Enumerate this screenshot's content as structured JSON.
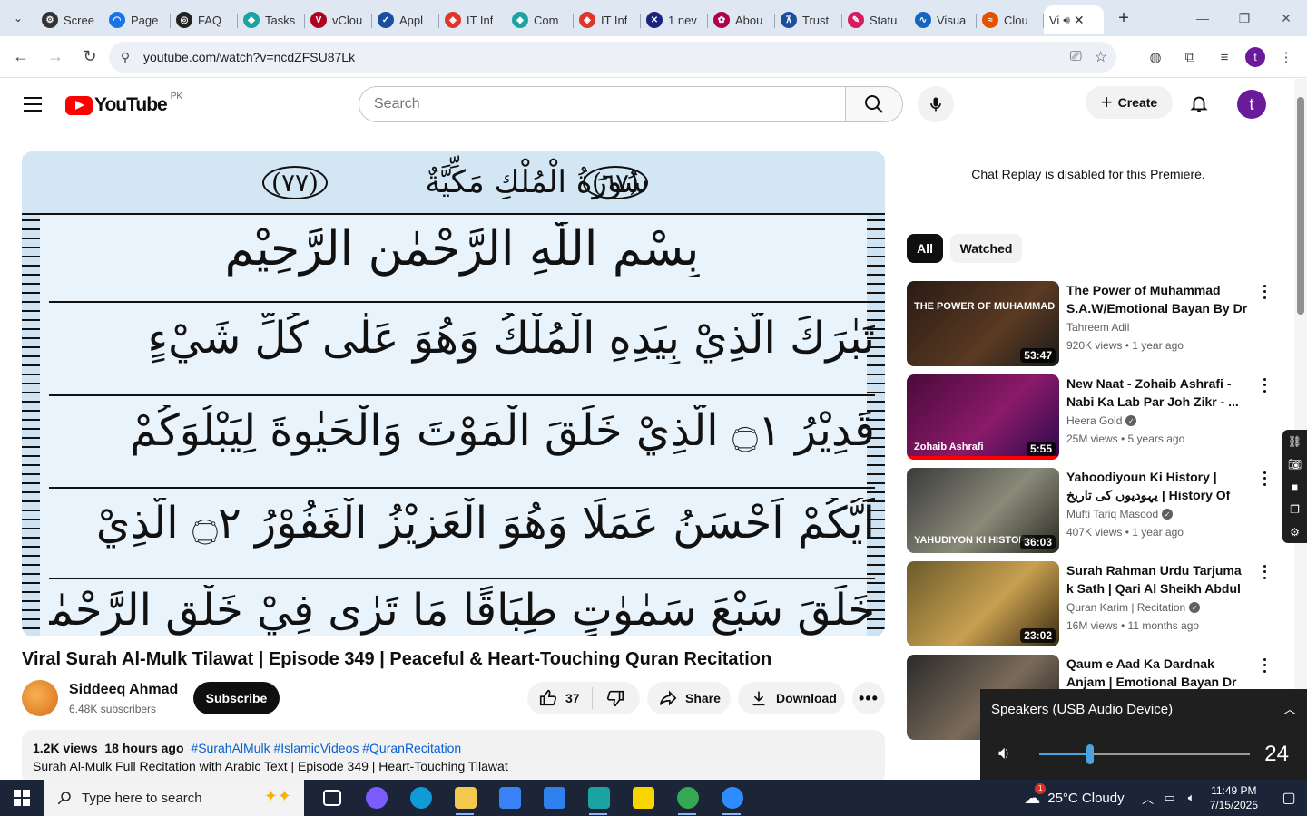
{
  "browser": {
    "tabs": [
      {
        "label": "Scree",
        "color": "#333333",
        "glyph": "⚙"
      },
      {
        "label": "Page",
        "color": "#1a73e8",
        "glyph": "◠"
      },
      {
        "label": "FAQ",
        "color": "#222222",
        "glyph": "◎"
      },
      {
        "label": "Tasks",
        "color": "#1aa3a3",
        "glyph": "◆"
      },
      {
        "label": "vClou",
        "color": "#b00020",
        "glyph": "V"
      },
      {
        "label": "Appl",
        "color": "#1a4fa0",
        "glyph": "✓"
      },
      {
        "label": "IT Inf",
        "color": "#e0352b",
        "glyph": "◈"
      },
      {
        "label": "Com",
        "color": "#1aa3a3",
        "glyph": "◆"
      },
      {
        "label": "IT Inf",
        "color": "#e0352b",
        "glyph": "◈"
      },
      {
        "label": "1 nev",
        "color": "#1a237e",
        "glyph": "✕"
      },
      {
        "label": "Abou",
        "color": "#b0004a",
        "glyph": "✿"
      },
      {
        "label": "Trust",
        "color": "#1a4fa0",
        "glyph": "⊼"
      },
      {
        "label": "Statu",
        "color": "#d81b60",
        "glyph": "✎"
      },
      {
        "label": "Visua",
        "color": "#1565c0",
        "glyph": "∿"
      },
      {
        "label": "Clou",
        "color": "#e65100",
        "glyph": "≈"
      }
    ],
    "active_tab": {
      "label": "Vi"
    },
    "url": "youtube.com/watch?v=ncdZFSU87Lk"
  },
  "yt": {
    "region": "PK",
    "logo_text": "YouTube",
    "search_placeholder": "Search",
    "create_label": "Create",
    "avatar_letter": "t"
  },
  "video": {
    "title": "Viral Surah Al-Mulk Tilawat | Episode 349 | Peaceful & Heart-Touching Quran Recitation",
    "channel": "Siddeeq Ahmad",
    "subscribers": "6.48K subscribers",
    "subscribe_label": "Subscribe",
    "likes": "37",
    "share_label": "Share",
    "download_label": "Download",
    "views": "1.2K views",
    "time": "18 hours ago",
    "tags": "#SurahAlMulk #IslamicVideos #QuranRecitation",
    "description_line": "Surah Al-Mulk Full Recitation with Arabic Text | Episode 349 | Heart-Touching Tilawat",
    "frame": {
      "header": "سُورَةُ الْمُلْكِ مَكِّيَّةٌ",
      "left_num": "(٧٧)",
      "right_num": "(٦٧)",
      "line1": "بِسْمِ اللّٰهِ الرَّحْمٰنِ الرَّحِيْمِ",
      "line2": "تَبٰرَكَ الَّذِيْ بِيَدِهِ الْمُلْكُ وَهُوَ عَلٰى كُلِّ شَيْءٍ",
      "line3": "قَدِيْرُ ۝١ الَّذِيْ خَلَقَ الْمَوْتَ وَالْحَيٰوةَ لِيَبْلُوَكُمْ",
      "line4": "اَيُّكُمْ اَحْسَنُ عَمَلًا وَهُوَ الْعَزِيْزُ الْغَفُوْرُ ۝٢ الَّذِيْ",
      "line5": "خَلَقَ سَبْعَ سَمٰوٰتٍ طِبَاقًا مَا تَرٰى فِيْ خَلْقِ الرَّحْمٰنِ"
    }
  },
  "sidebar": {
    "chat_replay": "Chat Replay is disabled for this Premiere.",
    "chips": [
      "All",
      "Watched"
    ],
    "recs": [
      {
        "title": "The Power of Muhammad S.A.W/Emotional Bayan By Dr ...",
        "channel": "Tahreem Adil",
        "verified": false,
        "views": "920K views • 1 year ago",
        "duration": "53:47",
        "cap": "THE POWER OF MUHAMMAD",
        "bg": "linear-gradient(135deg,#2a1a14,#5a3a22 60%,#1a1a1a)",
        "progress": 0
      },
      {
        "title": "New Naat - Zohaib Ashrafi - Nabi Ka Lab Par Joh Zikr - ...",
        "channel": "Heera Gold",
        "verified": true,
        "views": "25M views • 5 years ago",
        "duration": "5:55",
        "cap": "Zohaib Ashrafi",
        "bg": "linear-gradient(135deg,#4a0a3a,#8a1a6a 55%,#2a0a4a)",
        "progress": 1.0
      },
      {
        "title": "Yahoodiyoun Ki History | یہودیوں کی تاریخ | History Of Jews | Muft...",
        "channel": "Mufti Tariq Masood",
        "verified": true,
        "views": "407K views • 1 year ago",
        "duration": "36:03",
        "cap": "YAHUDIYON KI HISTORY",
        "bg": "linear-gradient(135deg,#3a3a3a,#8a8a7a 55%,#2a2a22)",
        "progress": 0
      },
      {
        "title": "Surah Rahman Urdu Tarjuma k Sath | Qari Al Sheikh Abdul Ba...",
        "channel": "Quran Karim | Recitation",
        "verified": true,
        "views": "16M views • 11 months ago",
        "duration": "23:02",
        "cap": "",
        "bg": "linear-gradient(135deg,#6a5a2a,#c8a050 55%,#3a2a12)",
        "progress": 0
      },
      {
        "title": "Qaum e Aad Ka Dardnak Anjam | Emotional Bayan Dr Israr ...",
        "channel": "",
        "verified": false,
        "views": "",
        "duration": "",
        "cap": "",
        "bg": "linear-gradient(135deg,#2a2a2a,#7a6a5a 55%,#1a1a1a)",
        "progress": 0
      }
    ]
  },
  "volume": {
    "device": "Speakers (USB Audio Device)",
    "value": "24",
    "level": 0.24
  },
  "taskbar": {
    "search_placeholder": "Type here to search",
    "weather": "25°C  Cloudy",
    "weather_badge": "1",
    "time": "11:49 PM",
    "date": "7/15/2025",
    "apps": [
      {
        "name": "task-view",
        "color": "#ffffff",
        "running": false
      },
      {
        "name": "copilot",
        "color": "#7b5cff",
        "running": false
      },
      {
        "name": "edge",
        "color": "#0f9bd7",
        "running": false
      },
      {
        "name": "file-explorer",
        "color": "#f2c94c",
        "running": true
      },
      {
        "name": "store",
        "color": "#3b82f6",
        "running": false
      },
      {
        "name": "mail",
        "color": "#2f80ed",
        "running": false
      },
      {
        "name": "app-blue",
        "color": "#1aa3a3",
        "running": true
      },
      {
        "name": "sticky-notes",
        "color": "#f7d600",
        "running": false
      },
      {
        "name": "chrome",
        "color": "#34a853",
        "running": true
      },
      {
        "name": "zoom",
        "color": "#2d8cff",
        "running": true
      }
    ]
  }
}
